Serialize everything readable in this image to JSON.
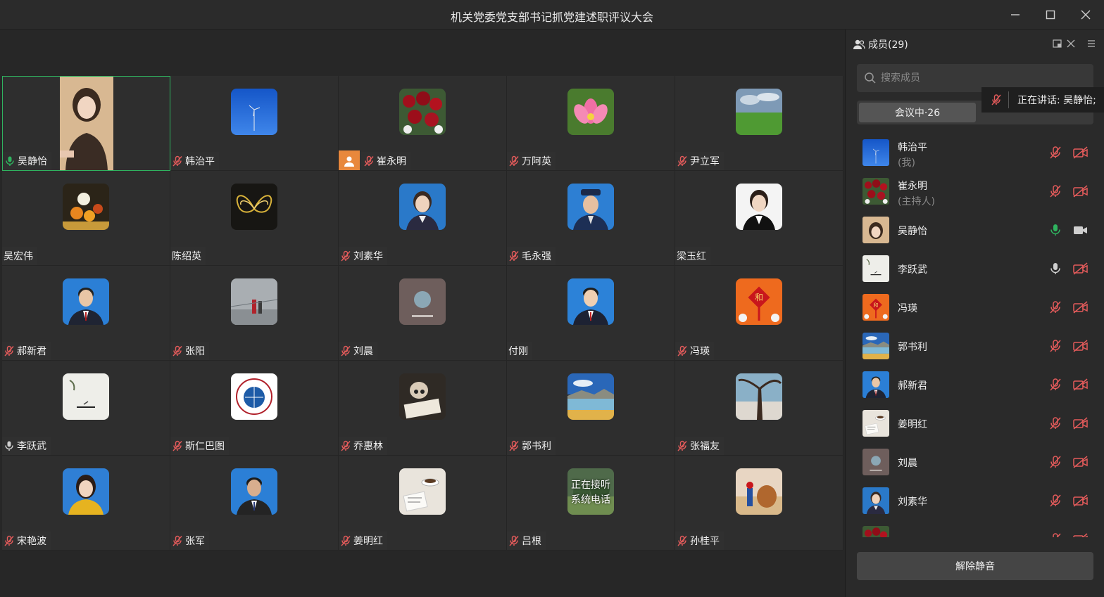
{
  "window": {
    "title": "机关党委党支部书记抓党建述职评议大会"
  },
  "tiles": [
    {
      "name": "吴静怡",
      "mic": "on",
      "art": "video",
      "active": true
    },
    {
      "name": "韩治平",
      "mic": "muted",
      "art": "sky"
    },
    {
      "name": "崔永明",
      "mic": "muted",
      "art": "flowers",
      "host": true
    },
    {
      "name": "万阿英",
      "mic": "muted",
      "art": "lotus"
    },
    {
      "name": "尹立军",
      "mic": "muted",
      "art": "field"
    },
    {
      "name": "吴宏伟",
      "mic": "none",
      "art": "fruit"
    },
    {
      "name": "陈绍英",
      "mic": "none",
      "art": "butterfly"
    },
    {
      "name": "刘素华",
      "mic": "muted",
      "art": "portrait-f"
    },
    {
      "name": "毛永强",
      "mic": "muted",
      "art": "police"
    },
    {
      "name": "梁玉红",
      "mic": "none",
      "art": "portrait-w"
    },
    {
      "name": "郝新君",
      "mic": "muted",
      "art": "portrait-m"
    },
    {
      "name": "张阳",
      "mic": "muted",
      "art": "walk"
    },
    {
      "name": "刘晨",
      "mic": "muted",
      "art": "card"
    },
    {
      "name": "付刚",
      "mic": "none",
      "art": "portrait-m2"
    },
    {
      "name": "冯瑛",
      "mic": "muted",
      "art": "knot"
    },
    {
      "name": "李跃武",
      "mic": "on-gray",
      "art": "ink"
    },
    {
      "name": "斯仁巴图",
      "mic": "muted",
      "art": "logo"
    },
    {
      "name": "乔惠林",
      "mic": "muted",
      "art": "child"
    },
    {
      "name": "郭书利",
      "mic": "muted",
      "art": "lake"
    },
    {
      "name": "张福友",
      "mic": "muted",
      "art": "tree"
    },
    {
      "name": "宋艳波",
      "mic": "muted",
      "art": "portrait-y"
    },
    {
      "name": "张军",
      "mic": "muted",
      "art": "portrait-m3"
    },
    {
      "name": "姜明红",
      "mic": "muted",
      "art": "coffee"
    },
    {
      "name": "吕根",
      "mic": "muted",
      "art": "phone",
      "overlay": "正在接听\n系统电话"
    },
    {
      "name": "孙桂平",
      "mic": "muted",
      "art": "camel"
    }
  ],
  "sidebar": {
    "title": "成员(29)",
    "search_placeholder": "搜索成员",
    "tab_active": "会议中·26",
    "speaking": "正在讲话: 吴静怡;",
    "unmute_label": "解除静音",
    "members": [
      {
        "name": "韩治平",
        "role": "(我)",
        "art": "sky",
        "mic": "muted",
        "cam": "off"
      },
      {
        "name": "崔永明",
        "role": "(主持人)",
        "art": "flowers",
        "mic": "muted",
        "cam": "off"
      },
      {
        "name": "吴静怡",
        "role": "",
        "art": "video",
        "mic": "on",
        "cam": "on"
      },
      {
        "name": "李跃武",
        "role": "",
        "art": "ink",
        "mic": "on-gray",
        "cam": "off"
      },
      {
        "name": "冯瑛",
        "role": "",
        "art": "knot",
        "mic": "muted",
        "cam": "off"
      },
      {
        "name": "郭书利",
        "role": "",
        "art": "lake",
        "mic": "muted",
        "cam": "off"
      },
      {
        "name": "郝新君",
        "role": "",
        "art": "portrait-m",
        "mic": "muted",
        "cam": "off"
      },
      {
        "name": "姜明红",
        "role": "",
        "art": "coffee",
        "mic": "muted",
        "cam": "off"
      },
      {
        "name": "刘晨",
        "role": "",
        "art": "card",
        "mic": "muted",
        "cam": "off"
      },
      {
        "name": "刘素华",
        "role": "",
        "art": "portrait-f",
        "mic": "muted",
        "cam": "off"
      },
      {
        "name": "",
        "role": "",
        "art": "flowers",
        "mic": "muted",
        "cam": "off"
      }
    ]
  },
  "colors": {
    "accent_green": "#2fb35f",
    "muted_red": "#e45b5b",
    "host_orange": "#e8883c"
  }
}
